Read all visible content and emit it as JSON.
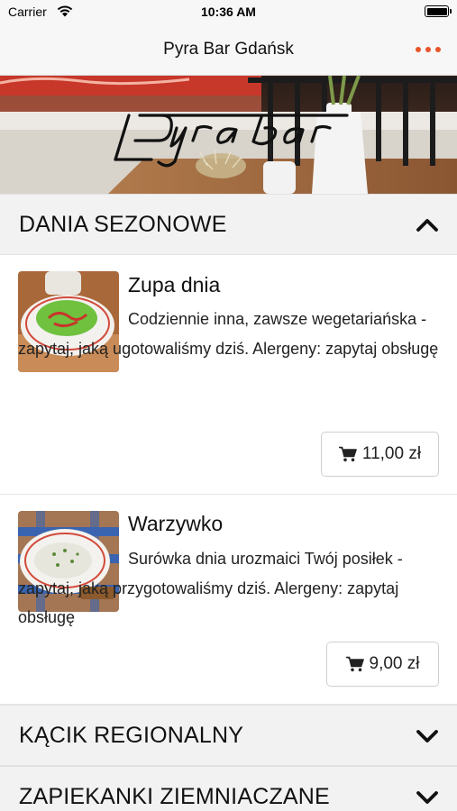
{
  "status_bar": {
    "carrier": "Carrier",
    "time": "10:36 AM"
  },
  "nav": {
    "title": "Pyra Bar Gdańsk",
    "more_icon": "more-dots-icon",
    "accent_color": "#e8542a"
  },
  "banner": {
    "logo_text": "Pyra bar"
  },
  "sections": [
    {
      "title": "DANIA SEZONOWE",
      "expanded": true,
      "chevron": "chevron-up-icon",
      "items": [
        {
          "name": "Zupa dnia",
          "description": "Codziennie inna, zawsze wegetariańska - zapytaj, jaką ugotowaliśmy dziś. Alergeny: zapytaj obsługę",
          "price": "11,00 zł",
          "cart_icon": "cart-icon"
        },
        {
          "name": "Warzywko",
          "description": "Surówka dnia urozmaici Twój posiłek - zapytaj, jaką przygotowaliśmy dziś. Alergeny: zapytaj obsługę",
          "price": "9,00 zł",
          "cart_icon": "cart-icon"
        }
      ]
    },
    {
      "title": "KĄCIK REGIONALNY",
      "expanded": false,
      "chevron": "chevron-down-icon"
    },
    {
      "title": "ZAPIEKANKI ZIEMNIACZANE",
      "expanded": false,
      "chevron": "chevron-down-icon"
    }
  ]
}
